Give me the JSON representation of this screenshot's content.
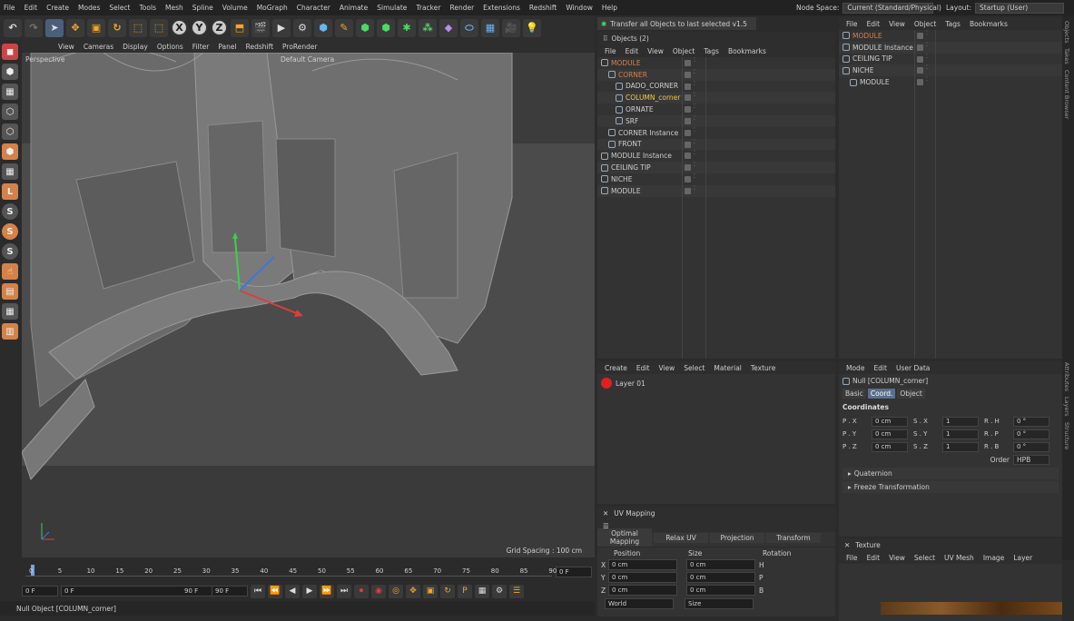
{
  "menubar": {
    "items": [
      "File",
      "Edit",
      "Create",
      "Modes",
      "Select",
      "Tools",
      "Mesh",
      "Spline",
      "Volume",
      "MoGraph",
      "Character",
      "Animate",
      "Simulate",
      "Tracker",
      "Render",
      "Extensions",
      "Redshift",
      "Window",
      "Help"
    ],
    "node_space_label": "Node Space:",
    "node_space_value": "Current (Standard/Physical)",
    "layout_label": "Layout:",
    "layout_value": "Startup (User)"
  },
  "toolbar": {
    "x": "X",
    "y": "Y",
    "z": "Z"
  },
  "viewport": {
    "menu": [
      "View",
      "Cameras",
      "Display",
      "Options",
      "Filter",
      "Panel",
      "Redshift",
      "ProRender"
    ],
    "label_left": "Perspective",
    "label_camera": "Default Camera",
    "grid_spacing": "Grid Spacing : 100 cm"
  },
  "timeline": {
    "ticks": [
      "0",
      "5",
      "10",
      "15",
      "20",
      "25",
      "30",
      "35",
      "40",
      "45",
      "50",
      "55",
      "60",
      "65",
      "70",
      "75",
      "80",
      "85",
      "90"
    ],
    "frame_right": "0 F",
    "start": "0 F",
    "current": "0 F",
    "end": "90 F",
    "end2": "90 F"
  },
  "status": {
    "text": "Null Object [COLUMN_corner]"
  },
  "transfer_script": "Transfer all Objects to last selected v1.5",
  "objects_panel": {
    "title": "Objects (2)",
    "menu": [
      "File",
      "Edit",
      "View",
      "Object",
      "Tags",
      "Bookmarks"
    ],
    "rows": [
      {
        "name": "MODULE",
        "indent": 0,
        "color": "#d4824a"
      },
      {
        "name": "CORNER",
        "indent": 1,
        "color": "#d4824a"
      },
      {
        "name": "DADO_CORNER",
        "indent": 2,
        "color": "#cfcfcf"
      },
      {
        "name": "COLUMN_corner",
        "indent": 2,
        "color": "#f2c94c"
      },
      {
        "name": "ORNATE",
        "indent": 2,
        "color": "#cfcfcf"
      },
      {
        "name": "SRF",
        "indent": 2,
        "color": "#cfcfcf"
      },
      {
        "name": "CORNER Instance",
        "indent": 1,
        "color": "#cfcfcf"
      },
      {
        "name": "FRONT",
        "indent": 1,
        "color": "#cfcfcf"
      },
      {
        "name": "MODULE Instance",
        "indent": 0,
        "color": "#cfcfcf"
      },
      {
        "name": "CEILING TIP",
        "indent": 0,
        "color": "#cfcfcf"
      },
      {
        "name": "NICHE",
        "indent": 0,
        "color": "#cfcfcf"
      },
      {
        "name": "MODULE",
        "indent": 0,
        "color": "#cfcfcf"
      }
    ]
  },
  "objects_panel2": {
    "menu": [
      "File",
      "Edit",
      "View",
      "Object",
      "Tags",
      "Bookmarks"
    ],
    "rows": [
      {
        "name": "MODULE",
        "indent": 0,
        "color": "#d4824a"
      },
      {
        "name": "MODULE Instance",
        "indent": 0,
        "color": "#cfcfcf"
      },
      {
        "name": "CEILING TIP",
        "indent": 0,
        "color": "#cfcfcf"
      },
      {
        "name": "NICHE",
        "indent": 0,
        "color": "#cfcfcf"
      },
      {
        "name": "MODULE",
        "indent": 1,
        "color": "#cfcfcf"
      }
    ]
  },
  "material_panel": {
    "menu": [
      "Create",
      "Edit",
      "View",
      "Select",
      "Material",
      "Texture"
    ],
    "layer": "Layer 01"
  },
  "uv_panel": {
    "title": "UV Mapping",
    "tabs": [
      "Optimal Mapping",
      "Relax UV",
      "Projection",
      "Transform"
    ]
  },
  "coord_manager": {
    "headers": [
      "Position",
      "Size",
      "Rotation"
    ],
    "rows": [
      {
        "axis": "X",
        "pos": "0 cm",
        "size": "0 cm",
        "rot": "H"
      },
      {
        "axis": "Y",
        "pos": "0 cm",
        "size": "0 cm",
        "rot": "P"
      },
      {
        "axis": "Z",
        "pos": "0 cm",
        "size": "0 cm",
        "rot": "B"
      }
    ],
    "mode1": "World",
    "mode2": "Size"
  },
  "attributes": {
    "menu": [
      "Mode",
      "Edit",
      "User Data"
    ],
    "object_title": "Null [COLUMN_corner]",
    "tabs": [
      "Basic",
      "Coord.",
      "Object"
    ],
    "section": "Coordinates",
    "rows": [
      {
        "p": "P . X",
        "pv": "0 cm",
        "s": "S . X",
        "sv": "1",
        "r": "R . H",
        "rv": "0 °"
      },
      {
        "p": "P . Y",
        "pv": "0 cm",
        "s": "S . Y",
        "sv": "1",
        "r": "R . P",
        "rv": "0 °"
      },
      {
        "p": "P . Z",
        "pv": "0 cm",
        "s": "S . Z",
        "sv": "1",
        "r": "R . B",
        "rv": "0 °"
      }
    ],
    "order_label": "Order",
    "order_value": "HPB",
    "quaternion": "Quaternion",
    "freeze": "Freeze Transformation"
  },
  "texture_panel": {
    "title": "Texture",
    "menu": [
      "File",
      "Edit",
      "View",
      "Select",
      "UV Mesh",
      "Image",
      "Layer"
    ]
  },
  "side_tabs": [
    "Objects",
    "Takes",
    "Content Browser",
    "Attributes",
    "Layers",
    "Structure"
  ]
}
